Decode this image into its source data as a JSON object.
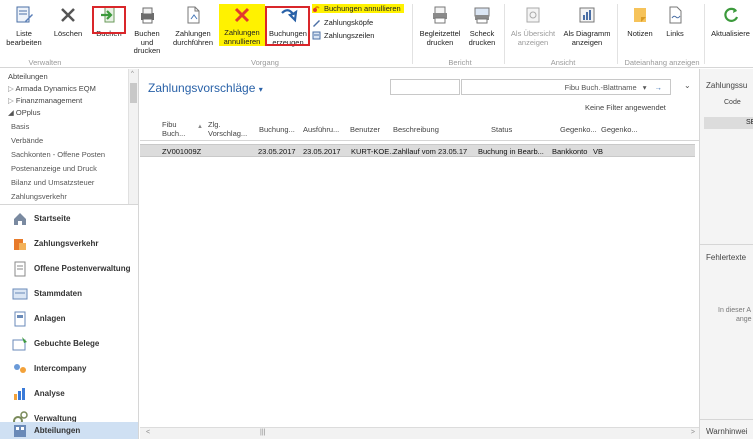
{
  "ribbon": {
    "buttons": {
      "liste_bearbeiten": "Liste\nbearbeiten",
      "loeschen": "Löschen",
      "buchen": "Buchen",
      "buchen_drucken": "Buchen und\ndrucken",
      "zahlungen_durchfuehren": "Zahlungen\ndurchführen",
      "zahlungen_annullieren": "Zahlungen\nannullieren",
      "buchungen_erzeugen": "Buchungen\nerzeugen",
      "buchungen_annullieren": "Buchungen annullieren",
      "zahlungskoepfe": "Zahlungsköpfe",
      "zahlungszeilen": "Zahlungszeilen",
      "begleitzettel_drucken": "Begleitzettel\ndrucken",
      "scheck_drucken": "Scheck\ndrucken",
      "als_uebersicht": "Als Übersicht\nanzeigen",
      "als_diagramm": "Als Diagramm\nanzeigen",
      "notizen": "Notizen",
      "links": "Links",
      "aktualisieren": "Aktualisiere"
    },
    "groups": {
      "verwalten": "Verwalten",
      "vorgang": "Vorgang",
      "bericht": "Bericht",
      "ansicht": "Ansicht",
      "dateianhang": "Dateianhang anzeigen"
    },
    "colors": {
      "accent": "#2a62a8",
      "highlight": "#fff200",
      "callout": "#d9262a"
    }
  },
  "tree": {
    "items": [
      "Abteilungen",
      "Armada Dynamics EQM",
      "Finanzmanagement",
      "OPplus",
      "Basis",
      "Verbände",
      "Sachkonten - Offene Posten",
      "Postenanzeige und Druck",
      "Bilanz und Umsatzsteuer",
      "Zahlungsverkehr"
    ]
  },
  "nav": {
    "items": [
      "Startseite",
      "Zahlungsverkehr",
      "Offene Postenverwaltung",
      "Stammdaten",
      "Anlagen",
      "Gebuchte Belege",
      "Intercompany",
      "Analyse",
      "Verwaltung",
      "Abteilungen"
    ]
  },
  "main": {
    "title": "Zahlungsvorschläge",
    "filter_field": "Fibu Buch.-Blattname",
    "filter_status": "Keine Filter angewendet",
    "columns": [
      "Fibu\nBuch...",
      "Zlg.\nVorschlag...",
      "Buchung...",
      "Ausführu...",
      "Benutzer",
      "Beschreibung",
      "Status",
      "Gegenko...",
      "Gegenko..."
    ],
    "row": {
      "zlg_vorschlag": "ZV001009Z",
      "buchungsdatum": "23.05.2017",
      "ausfuehrung": "23.05.2017",
      "benutzer": "KURT-KOE...",
      "beschreibung": "Zahllauf vom 23.05.17",
      "status": "Buchung in Bearb...",
      "gegenkonto_art": "Bankkonto",
      "gegenkonto_nr": "VB"
    }
  },
  "rightpane": {
    "section1": "Zahlungssu",
    "code": "Code",
    "se": "SE",
    "section2": "Fehlertexte",
    "note1": "In dieser A",
    "note2": "ange",
    "section3": "Warnhinwei"
  }
}
